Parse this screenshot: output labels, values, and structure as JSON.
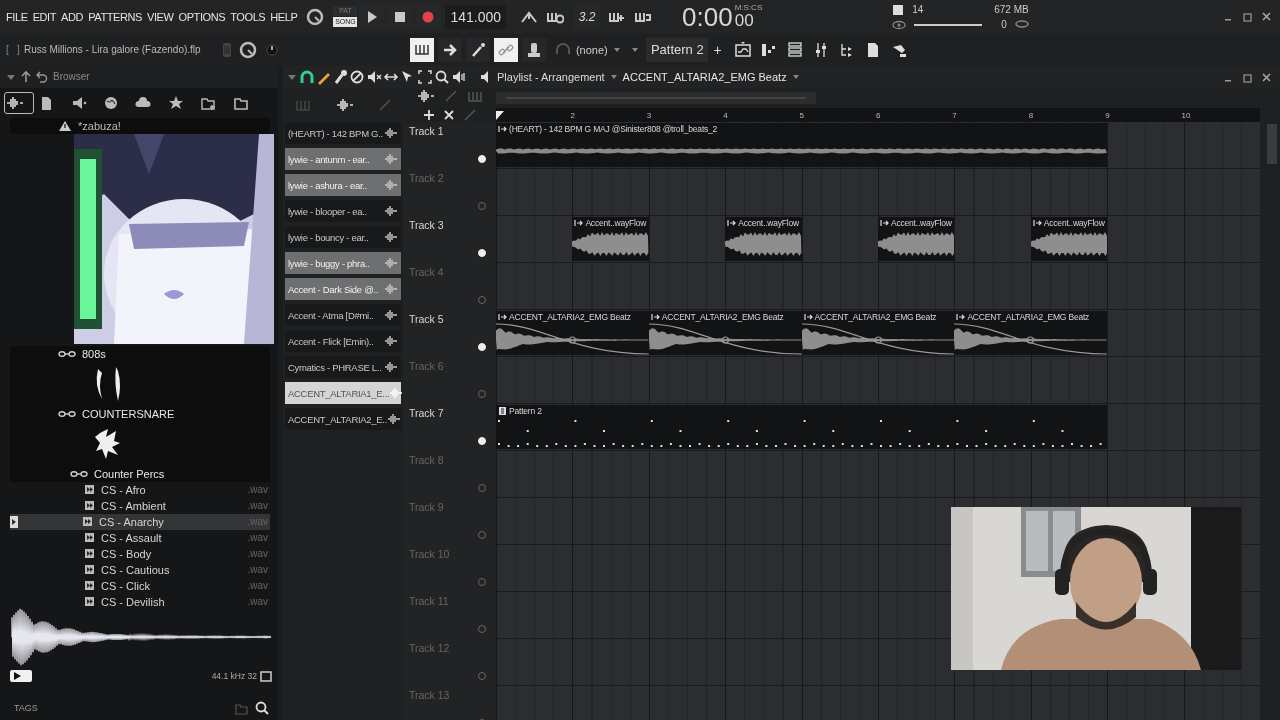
{
  "menu": [
    "FILE",
    "EDIT",
    "ADD",
    "PATTERNS",
    "VIEW",
    "OPTIONS",
    "TOOLS",
    "HELP"
  ],
  "hint_bar": "[   ]",
  "project_file": "Russ Millions - Lira galore (Fazendo).flp",
  "transport": {
    "modes": [
      {
        "label": "PAT",
        "selected": false
      },
      {
        "label": "SONG",
        "selected": true
      }
    ],
    "tempo": "141.000",
    "time": "0:00",
    "time_cs": "00",
    "time_format": "M:S:CS"
  },
  "record_buttons": [
    {
      "kind": "metronome"
    },
    {
      "kind": "wait"
    },
    {
      "kind": "countdown",
      "label": "3.2"
    },
    {
      "kind": "step-edit"
    },
    {
      "kind": "loop-record"
    }
  ],
  "monitor": {
    "cpu": "14",
    "memory": "672 MB",
    "polyphony": "0"
  },
  "quick_buttons": [
    {
      "kind": "keyboard",
      "on": true
    },
    {
      "kind": "arrow",
      "on": false
    },
    {
      "kind": "wand",
      "on": false
    },
    {
      "kind": "link",
      "on": true
    },
    {
      "kind": "mixer-knob",
      "on": false
    }
  ],
  "snap": "(none)",
  "pattern": "Pattern 2",
  "add_pattern": "+",
  "browser": {
    "title": "Browser",
    "tabs": [
      {
        "kind": "all",
        "selected": true
      },
      {
        "kind": "file",
        "selected": false
      },
      {
        "kind": "speaker",
        "selected": false
      },
      {
        "kind": "globe",
        "selected": false
      },
      {
        "kind": "cloud",
        "selected": false
      },
      {
        "kind": "star",
        "selected": false
      },
      {
        "kind": "folder-add",
        "selected": false
      },
      {
        "kind": "folder",
        "selected": false
      }
    ],
    "tree": [
      {
        "kind": "pack",
        "name": "*zabuza!"
      },
      {
        "kind": "linked-claw",
        "name": "808s"
      },
      {
        "kind": "linked-emblem",
        "name": "COUNTERSNARE",
        "children": [
          {
            "kind": "linked",
            "name": "Counter Percs",
            "children": [
              {
                "kind": "file",
                "name": "CS - Afro",
                "ext": ".wav",
                "selected": false
              },
              {
                "kind": "file",
                "name": "CS - Ambient",
                "ext": ".wav",
                "selected": false
              },
              {
                "kind": "file",
                "name": "CS - Anarchy",
                "ext": ".wav",
                "selected": true
              },
              {
                "kind": "file",
                "name": "CS - Assault",
                "ext": ".wav",
                "selected": false
              },
              {
                "kind": "file",
                "name": "CS - Body",
                "ext": ".wav",
                "selected": false
              },
              {
                "kind": "file",
                "name": "CS - Cautious",
                "ext": ".wav",
                "selected": false
              },
              {
                "kind": "file",
                "name": "CS - Click",
                "ext": ".wav",
                "selected": false
              },
              {
                "kind": "file",
                "name": "CS - Devilish",
                "ext": ".wav",
                "selected": false
              }
            ]
          }
        ]
      }
    ],
    "preview_info": "44.1 kHz 32",
    "tags": "TAGS"
  },
  "channels": [
    {
      "name": "(HEART) - 142 BPM G..",
      "selected": false,
      "focused": false
    },
    {
      "name": "lywie - antunm - ear..",
      "selected": true,
      "focused": false
    },
    {
      "name": "lywie - ashura - ear..",
      "selected": true,
      "focused": false
    },
    {
      "name": "lywie - blooper - ea..",
      "selected": false,
      "focused": false
    },
    {
      "name": "lywie - bouncy - ear..",
      "selected": false,
      "focused": false
    },
    {
      "name": "lywie - buggy - phra..",
      "selected": true,
      "focused": false
    },
    {
      "name": "Accent - Dark Side @..",
      "selected": true,
      "focused": false
    },
    {
      "name": "Accent - Atma [D#mi..",
      "selected": false,
      "focused": false
    },
    {
      "name": "Accent - Flick [Emin)..",
      "selected": false,
      "focused": false
    },
    {
      "name": "Cymatics - PHRASE L..",
      "selected": false,
      "focused": false
    },
    {
      "name": "ACCENT_ALTARIA1_E...",
      "selected": true,
      "focused": true
    },
    {
      "name": "ACCENT_ALTARIA2_E..",
      "selected": false,
      "focused": false
    }
  ],
  "playlist": {
    "title": "Playlist - Arrangement",
    "pattern": "ACCENT_ALTARIA2_EMG Beatz",
    "ruler": [
      "2",
      "3",
      "4",
      "5",
      "6",
      "7",
      "8",
      "9",
      "10"
    ],
    "tracks": [
      {
        "name": "Track 1",
        "lane": [
          {
            "kind": "audio-line",
            "name": "(HEART) - 142 BPM G MAJ @Sinister808 @troll_beats_2"
          }
        ]
      },
      {
        "name": "Track 2"
      },
      {
        "name": "Track 3",
        "lane": [
          {
            "kind": "gap"
          },
          {
            "kind": "audio-swell",
            "name": "Accent..wayFlow"
          },
          {
            "kind": "gap"
          },
          {
            "kind": "audio-swell",
            "name": "Accent..wayFlow"
          },
          {
            "kind": "gap"
          },
          {
            "kind": "audio-swell",
            "name": "Accent..wayFlow"
          },
          {
            "kind": "gap"
          },
          {
            "kind": "audio-swell",
            "name": "Accent..wayFlow"
          }
        ]
      },
      {
        "name": "Track 4"
      },
      {
        "name": "Track 5",
        "lane": [
          {
            "kind": "audio-decay",
            "name": "ACCENT_ALTARIA2_EMG Beatz"
          },
          {
            "kind": "audio-decay",
            "name": "ACCENT_ALTARIA2_EMG Beatz"
          },
          {
            "kind": "audio-decay",
            "name": "ACCENT_ALTARIA2_EMG Beatz"
          },
          {
            "kind": "audio-decay",
            "name": "ACCENT_ALTARIA2_EMG Beatz"
          }
        ]
      },
      {
        "name": "Track 6"
      },
      {
        "name": "Track 7",
        "lane": [
          {
            "kind": "pattern",
            "name": "Pattern 2"
          }
        ]
      },
      {
        "name": "Track 8"
      },
      {
        "name": "Track 9"
      },
      {
        "name": "Track 10"
      },
      {
        "name": "Track 11"
      },
      {
        "name": "Track 12"
      },
      {
        "name": "Track 13"
      }
    ]
  },
  "webcam": {
    "kind": "picture"
  }
}
